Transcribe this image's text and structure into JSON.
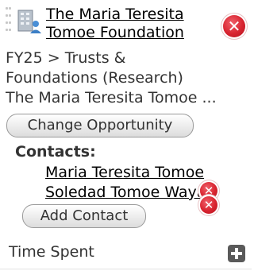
{
  "organization": {
    "name": "The Maria Teresita Tomoe Foundation",
    "icon": "organization-building-icon",
    "remove_icon": "remove-icon"
  },
  "opportunity": {
    "lines": [
      "FY25 > Trusts &",
      "Foundations (Research)",
      "The Maria Teresita Tomoe ..."
    ],
    "change_button_label": "Change Opportunity"
  },
  "contacts": {
    "label": "Contacts:",
    "items": [
      {
        "name": "Maria Teresita Tomoe"
      },
      {
        "name": "Soledad Tomoe Wayan"
      }
    ],
    "add_button_label": "Add Contact"
  },
  "time_spent": {
    "label": "Time Spent",
    "add_icon": "plus-icon"
  },
  "colors": {
    "remove_red": "#d8232f",
    "add_icon_gray": "#5a5a5a",
    "text": "#333333"
  }
}
